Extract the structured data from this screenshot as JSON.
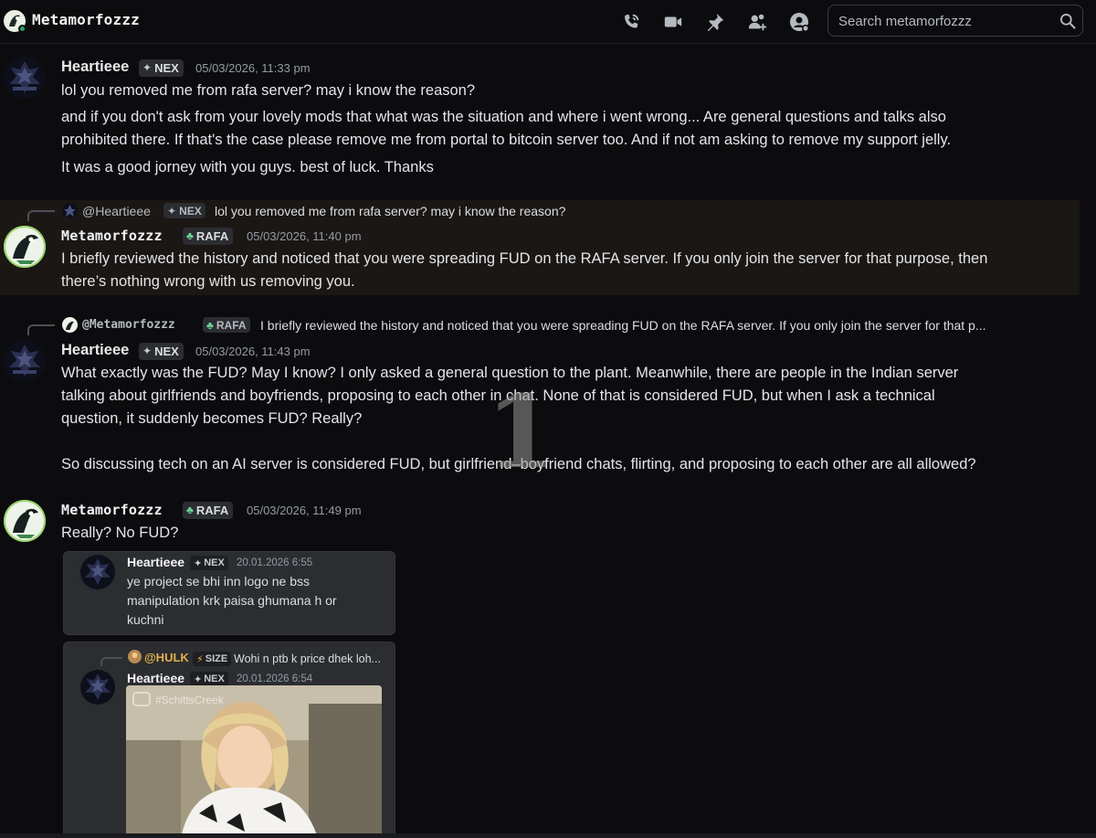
{
  "header": {
    "title": "Metamorfozzz",
    "icons": [
      "phone-icon",
      "video-icon",
      "pin-icon",
      "add-friend-icon",
      "profile-icon"
    ],
    "search_placeholder": "Search metamorfozzz"
  },
  "messages": [
    {
      "author": "Heartieee",
      "tag": "NEX",
      "timestamp": "05/03/2026, 11:33 pm",
      "lines": [
        "lol you removed me from rafa server? may i know the reason?",
        "and if you don't ask from your lovely mods that what was the situation and where i went wrong... Are general questions and talks also\nprohibited there. If that's the case please remove me from portal to bitcoin server too. And if not am asking to remove my support jelly.",
        "It was a good jorney with you guys. best of luck. Thanks"
      ]
    },
    {
      "reply_to": {
        "author": "@Heartieee",
        "tag": "NEX",
        "text": "lol you removed me from rafa server? may i know the reason?"
      },
      "author": "Metamorfozzz",
      "tag": "RAFA",
      "timestamp": "05/03/2026, 11:40 pm",
      "text": "I briefly reviewed the history and noticed that you were spreading FUD on the RAFA server. If you only join the server for that purpose, then\nthere’s nothing wrong with us removing you."
    },
    {
      "reply_to": {
        "author": "@Metamorfozzz",
        "tag": "RAFA",
        "text": "I briefly reviewed the history and noticed that you were spreading FUD on the RAFA server. If you only join the server for that p..."
      },
      "author": "Heartieee",
      "tag": "NEX",
      "timestamp": "05/03/2026, 11:43 pm",
      "text": "What exactly was the FUD? May I know? I only asked a general question to the plant. Meanwhile, there are people in the Indian server\ntalking about girlfriends and boyfriends, proposing to each other in chat. None of that is considered FUD, but when I ask a technical\nquestion, it suddenly becomes FUD? Really?\n\nSo discussing tech on an AI server is considered FUD, but girlfriend–boyfriend chats, flirting, and proposing to each other are all allowed?"
    },
    {
      "author": "Metamorfozzz",
      "tag": "RAFA",
      "timestamp": "05/03/2026, 11:49 pm",
      "text": "Really? No FUD?",
      "embeds": [
        {
          "author": "Heartieee",
          "tag": "NEX",
          "timestamp": "20.01.2026 6:55",
          "text": "ye project se bhi inn logo ne bss\nmanipulation krk paisa ghumana h or\nkuchni"
        },
        {
          "reply_to": {
            "author": "@HULK",
            "tag": "SIZE",
            "text": "Wohi n ptb k price dhek loh..."
          },
          "author": "Heartieee",
          "tag": "NEX",
          "timestamp": "20.01.2026 6:54",
          "gif_label": "#SchittsCreek"
        }
      ]
    }
  ],
  "watermark": "1",
  "colors": {
    "background": "#0c0c0e",
    "highlight": "#1b1714",
    "embed_bg": "#2b2d31",
    "rafa_tag_icon": "#6fd39a",
    "hulk_name": "#e2b04a"
  }
}
